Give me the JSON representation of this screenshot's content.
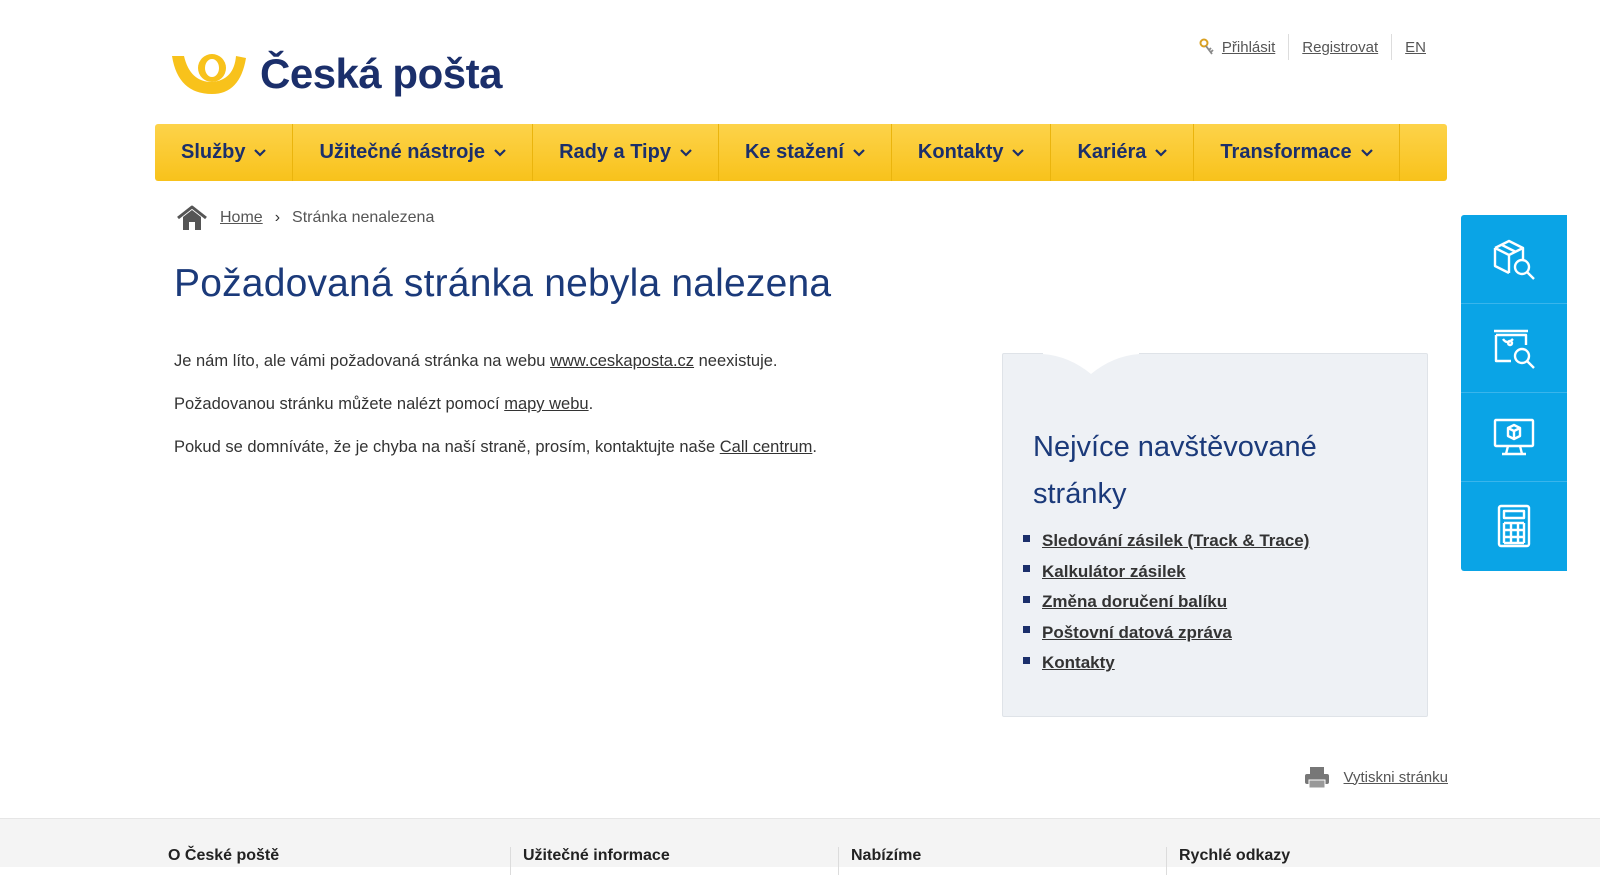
{
  "brand": {
    "name": "Česká pošta",
    "color": "#1b2f6b",
    "accent": "#f8c21b"
  },
  "top_links": {
    "login": "Přihlásit",
    "register": "Registrovat",
    "language": "EN"
  },
  "nav": {
    "items": [
      {
        "label": "Služby"
      },
      {
        "label": "Užitečné nástroje"
      },
      {
        "label": "Rady a Tipy"
      },
      {
        "label": "Ke stažení"
      },
      {
        "label": "Kontakty"
      },
      {
        "label": "Kariéra"
      },
      {
        "label": "Transformace"
      }
    ]
  },
  "breadcrumb": {
    "home": "Home",
    "separator": "›",
    "current": "Stránka nenalezena"
  },
  "main": {
    "title": "Požadovaná stránka nebyla nalezena",
    "p1": {
      "before": "Je nám líto, ale vámi požadovaná stránka na webu ",
      "link": "www.ceskaposta.cz",
      "after": " neexistuje."
    },
    "p2": {
      "before": "Požadovanou stránku můžete nalézt pomocí ",
      "link": "mapy webu",
      "after": "."
    },
    "p3": {
      "before": "Pokud se domníváte, že je chyba na naší straně, prosím, kontaktujte naše ",
      "link": "Call centrum",
      "after": "."
    }
  },
  "sidebar": {
    "title": "Nejvíce navštěvované stránky",
    "links": [
      {
        "label": "Sledování zásilek (Track & Trace)"
      },
      {
        "label": "Kalkulátor zásilek"
      },
      {
        "label": "Změna doručení balíku"
      },
      {
        "label": "Poštovní datová zpráva"
      },
      {
        "label": "Kontakty"
      }
    ]
  },
  "tools": {
    "color": "#0aa4e6",
    "icons": [
      "package-search-icon",
      "branch-search-icon",
      "online-service-icon",
      "calculator-icon"
    ]
  },
  "print": {
    "label": "Vytiskni stránku"
  },
  "footer": {
    "columns": [
      "O České poště",
      "Užitečné informace",
      "Nabízíme",
      "Rychlé odkazy"
    ]
  }
}
